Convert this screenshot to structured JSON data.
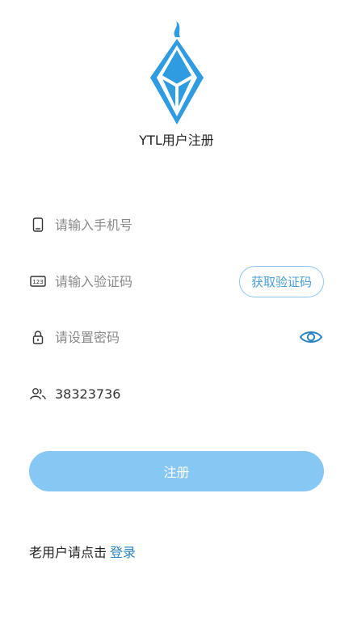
{
  "header": {
    "title": "YTL用户注册"
  },
  "form": {
    "phone": {
      "value": "",
      "placeholder": "请输入手机号"
    },
    "code": {
      "value": "",
      "placeholder": "请输入验证码"
    },
    "get_code_label": "获取验证码",
    "password": {
      "value": "",
      "placeholder": "请设置密码"
    },
    "invite": {
      "value": "38323736",
      "placeholder": ""
    }
  },
  "actions": {
    "register_label": "注册",
    "login_prompt": "老用户请点击",
    "login_link": "登录"
  },
  "icons": {
    "logo": "crystal-logo",
    "phone": "mobile-phone-icon",
    "code": "verification-code-icon",
    "password": "lock-icon",
    "visibility": "eye-icon",
    "invite": "users-icon"
  },
  "colors": {
    "accent": "#2a83c2",
    "logo_blue": "#2f9be0",
    "button_bg": "#86c7f3",
    "code_button_border": "#8fc7ec"
  }
}
